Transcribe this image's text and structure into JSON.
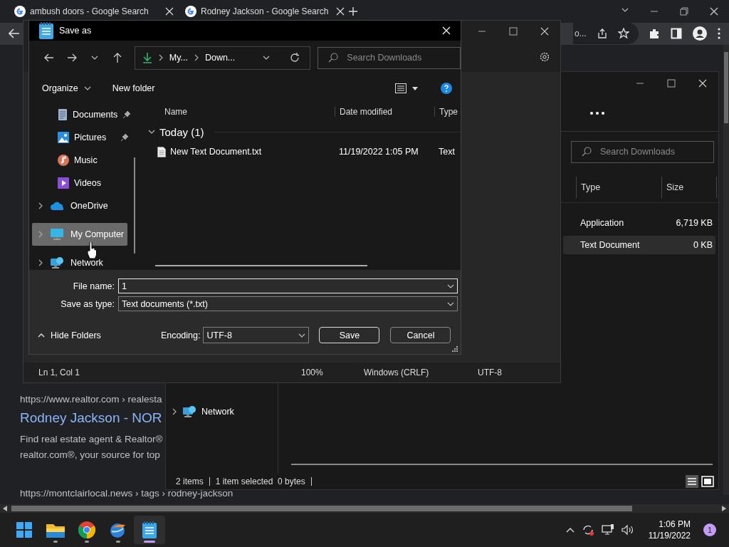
{
  "browser": {
    "tabs": [
      {
        "title": "ambush doors - Google Search"
      },
      {
        "title": "Rodney Jackson - Google Search"
      }
    ],
    "address_fragment": "o...",
    "results": [
      {
        "kind": "url",
        "text": "https://www.realtor.com › realesta"
      },
      {
        "kind": "link",
        "text": "Rodney Jackson - NOR"
      },
      {
        "kind": "snippet",
        "text": "Find real estate agent & Realtor®"
      },
      {
        "kind": "snippet",
        "text": "realtor.com®, your source for top"
      },
      {
        "kind": "url",
        "text": "https://montclairlocal.news › tags › rodney-jackson"
      }
    ]
  },
  "explorer": {
    "search": {
      "placeholder": "Search Downloads"
    },
    "columns": [
      "Type",
      "Size"
    ],
    "rows": [
      {
        "type": "Application",
        "size": "6,719 KB",
        "selected": false
      },
      {
        "type": "Text Document",
        "size": "0 KB",
        "selected": true
      }
    ],
    "nav": [
      {
        "label": "Network",
        "kind": "network"
      }
    ],
    "status": [
      "2 items",
      "1 item selected  0 bytes"
    ]
  },
  "notepad": {
    "status": [
      "Ln 1, Col 1",
      "100%",
      "Windows (CRLF)",
      "UTF-8"
    ]
  },
  "dialog": {
    "title": "Save as",
    "breadcrumb": [
      "My...",
      "Down..."
    ],
    "search": {
      "placeholder": "Search Downloads"
    },
    "toolbar": [
      "Organize",
      "New folder"
    ],
    "quick_access": [
      {
        "label": "Documents",
        "kind": "documents",
        "pinned": true
      },
      {
        "label": "Pictures",
        "kind": "pictures",
        "pinned": true
      },
      {
        "label": "Music",
        "kind": "music",
        "pinned": false
      },
      {
        "label": "Videos",
        "kind": "videos",
        "pinned": false
      }
    ],
    "locations": [
      {
        "label": "OneDrive",
        "kind": "onedrive",
        "selected": false
      },
      {
        "label": "My Computer",
        "kind": "computer",
        "selected": true
      },
      {
        "label": "Network",
        "kind": "network",
        "selected": false
      }
    ],
    "columns": [
      "Name",
      "Date modified",
      "Type"
    ],
    "group": "Today (1)",
    "files": [
      {
        "name": "New Text Document.txt",
        "date": "11/19/2022 1:05 PM",
        "type": "Text"
      }
    ],
    "file_name_label": "File name:",
    "file_name": {
      "value": "1"
    },
    "type_label": "Save as type:",
    "save_as_type": {
      "value": "Text documents (*.txt)"
    },
    "hide_folders": "Hide Folders",
    "encoding_label": "Encoding:",
    "encoding": {
      "value": "UTF-8"
    },
    "buttons": [
      "Save",
      "Cancel"
    ]
  },
  "taskbar": {
    "apps": [
      {
        "kind": "explorer",
        "active": false
      },
      {
        "kind": "chrome",
        "active": false
      },
      {
        "kind": "browser",
        "active": false
      },
      {
        "kind": "notepad",
        "active": true
      }
    ],
    "time": "1:06 PM",
    "date": "11/19/2022",
    "badge": "1"
  }
}
